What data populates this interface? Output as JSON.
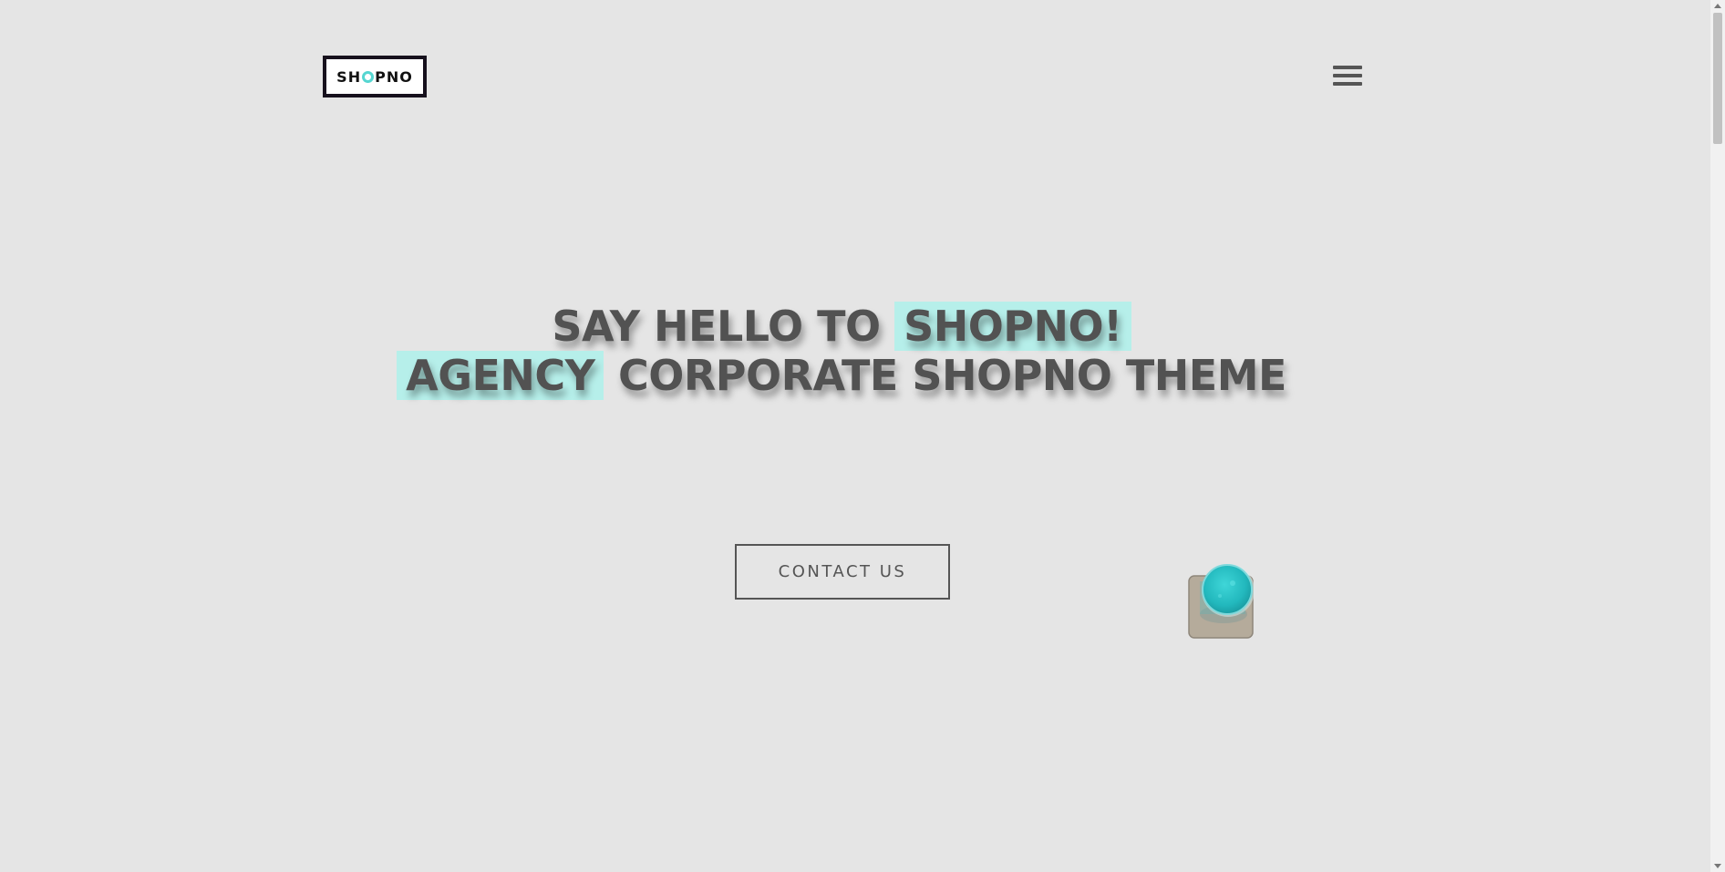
{
  "header": {
    "logo": {
      "prefix": "SH",
      "suffix": "PNO",
      "accent_color": "#55d6d1"
    },
    "menu_icon": "hamburger-menu-icon"
  },
  "hero": {
    "line1_plain": "SAY HELLO TO",
    "line1_highlight": "SHOPNO!",
    "line2_highlight": "AGENCY",
    "line2_plain": "CORPORATE SHOPNO THEME",
    "highlight_color": "#b6efea",
    "text_color": "#525252"
  },
  "cta": {
    "contact_label": "CONTACT US"
  },
  "colors": {
    "background": "#e5e5e5",
    "accent": "#55d6d1"
  }
}
